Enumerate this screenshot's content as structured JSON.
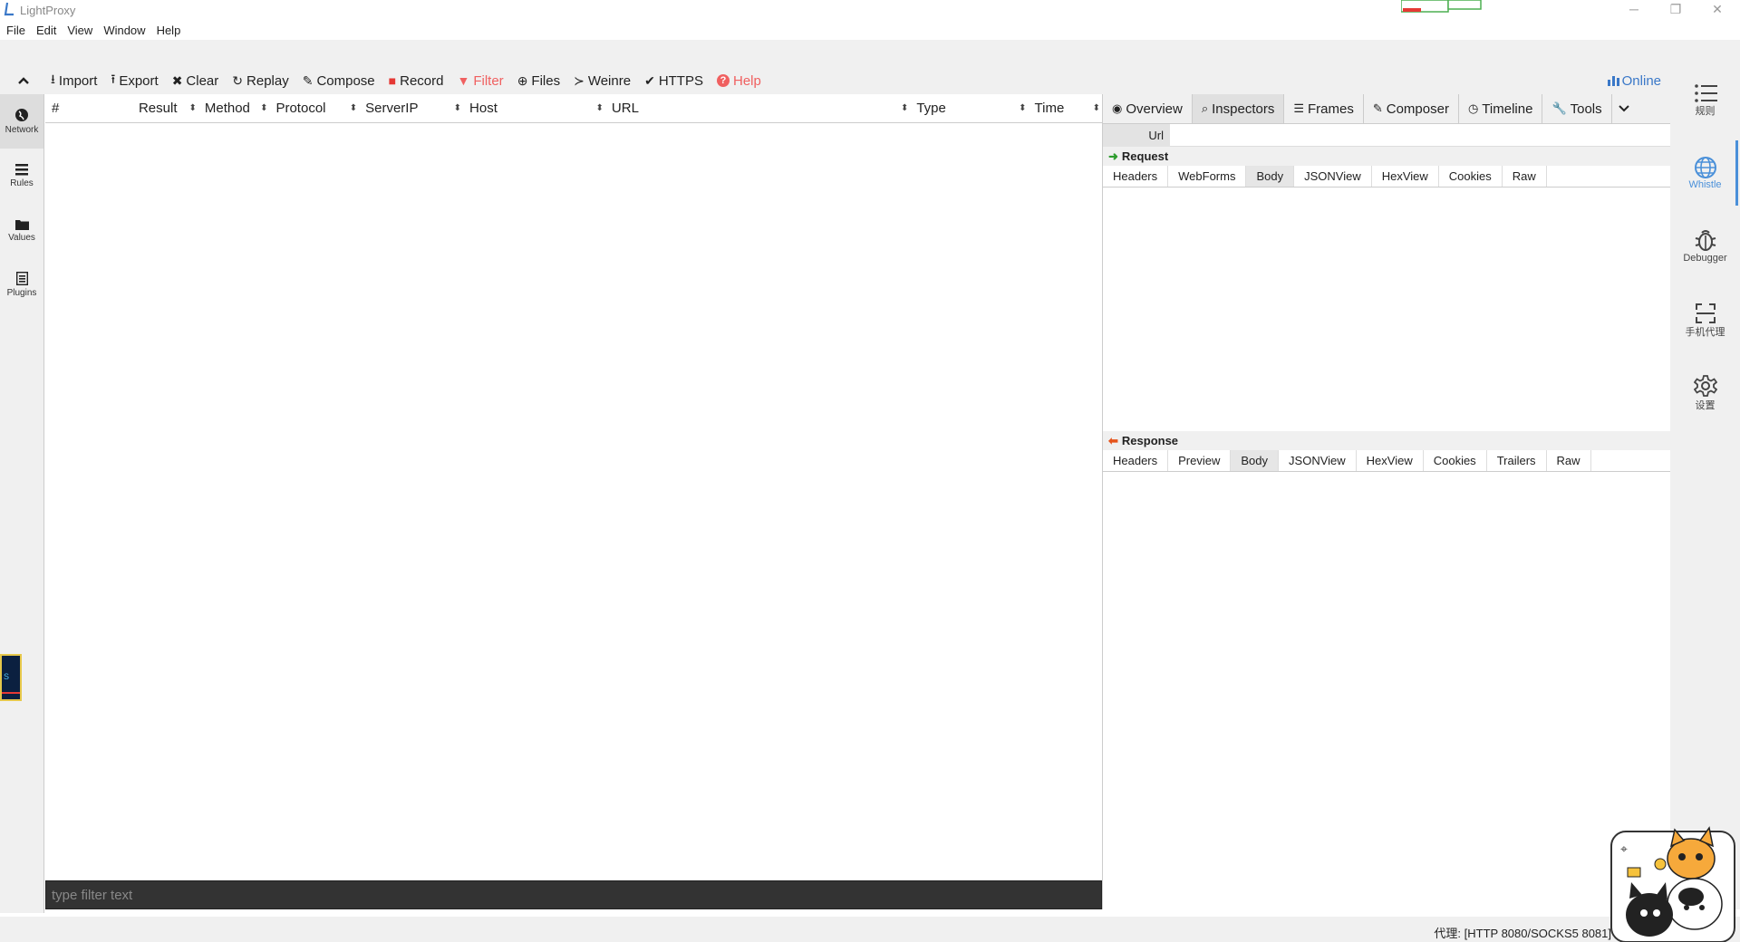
{
  "app": {
    "title": "LightProxy"
  },
  "window_controls": {
    "minimize": "─",
    "restore": "❐",
    "close": "✕"
  },
  "menu": [
    "File",
    "Edit",
    "View",
    "Window",
    "Help"
  ],
  "toolbar": {
    "collapse_icon": "chevron-up-icon",
    "buttons": [
      {
        "label": "Import",
        "icon": "import-icon",
        "glyph": "⭳",
        "color": "#222222"
      },
      {
        "label": "Export",
        "icon": "export-icon",
        "glyph": "⭱",
        "color": "#222222"
      },
      {
        "label": "Clear",
        "icon": "close-icon",
        "glyph": "✖",
        "color": "#222222"
      },
      {
        "label": "Replay",
        "icon": "refresh-icon",
        "glyph": "↻",
        "color": "#222222"
      },
      {
        "label": "Compose",
        "icon": "edit-icon",
        "glyph": "✎",
        "color": "#222222"
      },
      {
        "label": "Record",
        "icon": "record-icon",
        "glyph": "■",
        "color": "#e53935"
      },
      {
        "label": "Filter",
        "icon": "filter-icon",
        "glyph": "▼",
        "color": "#f06060"
      },
      {
        "label": "Files",
        "icon": "arrow-circle-icon",
        "glyph": "⊕",
        "color": "#222222"
      },
      {
        "label": "Weinre",
        "icon": "terminal-icon",
        "glyph": "≻",
        "color": "#222222"
      },
      {
        "label": "HTTPS",
        "icon": "check-icon",
        "glyph": "✔",
        "color": "#222222"
      },
      {
        "label": "Help",
        "icon": "help-icon",
        "glyph": "?",
        "color": "#f06060"
      }
    ],
    "online_label": "Online",
    "online_color": "#3a78c8"
  },
  "left_nav": [
    {
      "label": "Network",
      "icon": "globe-icon",
      "glyph": "●",
      "active": true
    },
    {
      "label": "Rules",
      "icon": "list-icon",
      "glyph": "☰",
      "active": false
    },
    {
      "label": "Values",
      "icon": "folder-icon",
      "glyph": "▬",
      "active": false
    },
    {
      "label": "Plugins",
      "icon": "plugin-icon",
      "glyph": "▤",
      "active": false
    }
  ],
  "network_table": {
    "columns": [
      "#",
      "Result",
      "Method",
      "Protocol",
      "ServerIP",
      "Host",
      "URL",
      "Type",
      "Time"
    ],
    "rows": []
  },
  "filter": {
    "placeholder": "type filter text"
  },
  "inspector": {
    "tabs": [
      {
        "label": "Overview",
        "icon": "eye-icon",
        "glyph": "◉"
      },
      {
        "label": "Inspectors",
        "icon": "search-icon",
        "glyph": "⌕",
        "active": true
      },
      {
        "label": "Frames",
        "icon": "list-icon",
        "glyph": "☰"
      },
      {
        "label": "Composer",
        "icon": "edit-icon",
        "glyph": "✎"
      },
      {
        "label": "Timeline",
        "icon": "clock-icon",
        "glyph": "◷"
      },
      {
        "label": "Tools",
        "icon": "wrench-icon",
        "glyph": "🔧"
      }
    ],
    "url_label": "Url",
    "request": {
      "title": "Request",
      "tabs": [
        "Headers",
        "WebForms",
        "Body",
        "JSONView",
        "HexView",
        "Cookies",
        "Raw"
      ],
      "active": "Body"
    },
    "response": {
      "title": "Response",
      "tabs": [
        "Headers",
        "Preview",
        "Body",
        "JSONView",
        "HexView",
        "Cookies",
        "Trailers",
        "Raw"
      ],
      "active": "Body"
    }
  },
  "right_sidebar": [
    {
      "label": "规则",
      "icon": "list-icon"
    },
    {
      "label": "Whistle",
      "icon": "globe-icon",
      "active": true
    },
    {
      "label": "Debugger",
      "icon": "bug-icon"
    },
    {
      "label": "手机代理",
      "icon": "scan-icon"
    },
    {
      "label": "设置",
      "icon": "gear-icon"
    }
  ],
  "status": {
    "text": "代理: [HTTP 8080/SOCKS5 8081]"
  }
}
